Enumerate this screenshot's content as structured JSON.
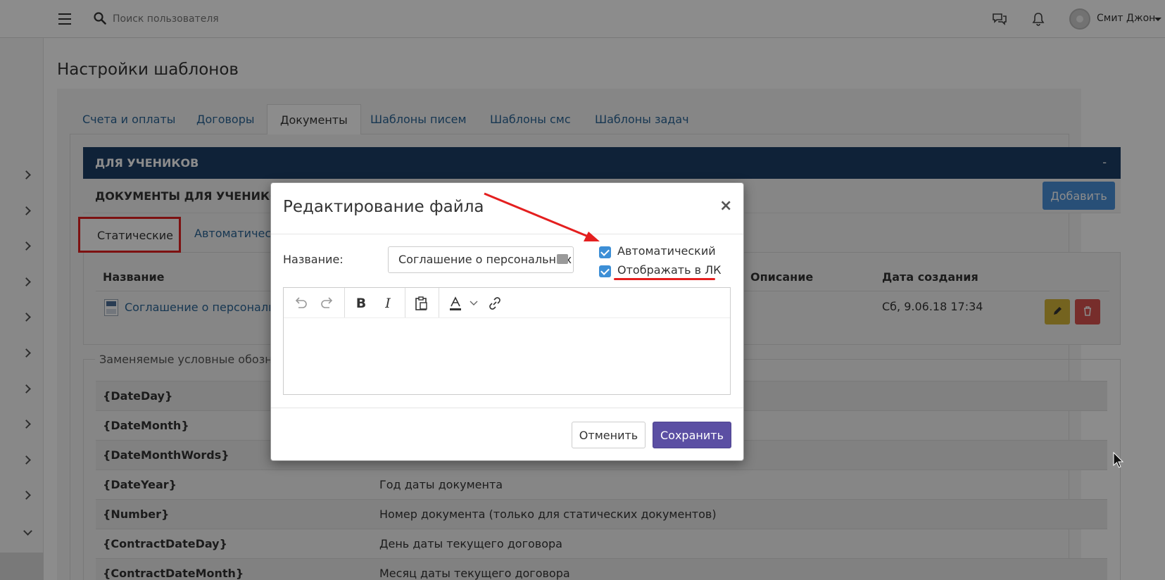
{
  "topbar": {
    "search_placeholder": "Поиск пользователя",
    "user_name": "Смит Джон"
  },
  "page": {
    "title": "Настройки шаблонов"
  },
  "tabs": [
    {
      "label": "Счета и оплаты",
      "active": false
    },
    {
      "label": "Договоры",
      "active": false
    },
    {
      "label": "Документы",
      "active": true
    },
    {
      "label": "Шаблоны писем",
      "active": false
    },
    {
      "label": "Шаблоны смс",
      "active": false
    },
    {
      "label": "Шаблоны задач",
      "active": false
    }
  ],
  "section": {
    "title": "ДЛЯ УЧЕНИКОВ",
    "toggle": "-",
    "subtitle": "ДОКУМЕНТЫ ДЛЯ УЧЕНИКОВ",
    "add_label": "Добавить"
  },
  "subtabs": {
    "static": "Статические",
    "auto": "Автоматичес"
  },
  "files_table": {
    "headers": {
      "name": "Название",
      "description": "Описание",
      "created": "Дата создания"
    },
    "rows": [
      {
        "name": "Соглашение о персональн",
        "created": "Сб, 9.06.18 17:34"
      }
    ]
  },
  "variables": {
    "legend": "Заменяемые условные обозначе",
    "rows": [
      {
        "key": "{DateDay}",
        "desc": ""
      },
      {
        "key": "{DateMonth}",
        "desc": ""
      },
      {
        "key": "{DateMonthWords}",
        "desc": ""
      },
      {
        "key": "{DateYear}",
        "desc": "Год даты документа"
      },
      {
        "key": "{Number}",
        "desc": "Номер документа (только для статических документов)"
      },
      {
        "key": "{ContractDateDay}",
        "desc": "День даты текущего договора"
      },
      {
        "key": "{ContractDateMonth}",
        "desc": "Месяц даты текущего договора"
      }
    ]
  },
  "modal": {
    "title": "Редактирование файла",
    "close": "×",
    "name_label": "Название:",
    "name_value": "Соглашение о персональных",
    "checkbox_auto": "Автоматический",
    "checkbox_auto_checked": true,
    "checkbox_lk": "Отображать в ЛК",
    "checkbox_lk_checked": true,
    "cancel": "Отменить",
    "save": "Сохранить"
  },
  "colors": {
    "section_bar": "#1d3f66",
    "link": "#2a6496",
    "save": "#5b4fa3",
    "checkbox": "#3d8fd6",
    "annotation": "#e41f1f"
  }
}
